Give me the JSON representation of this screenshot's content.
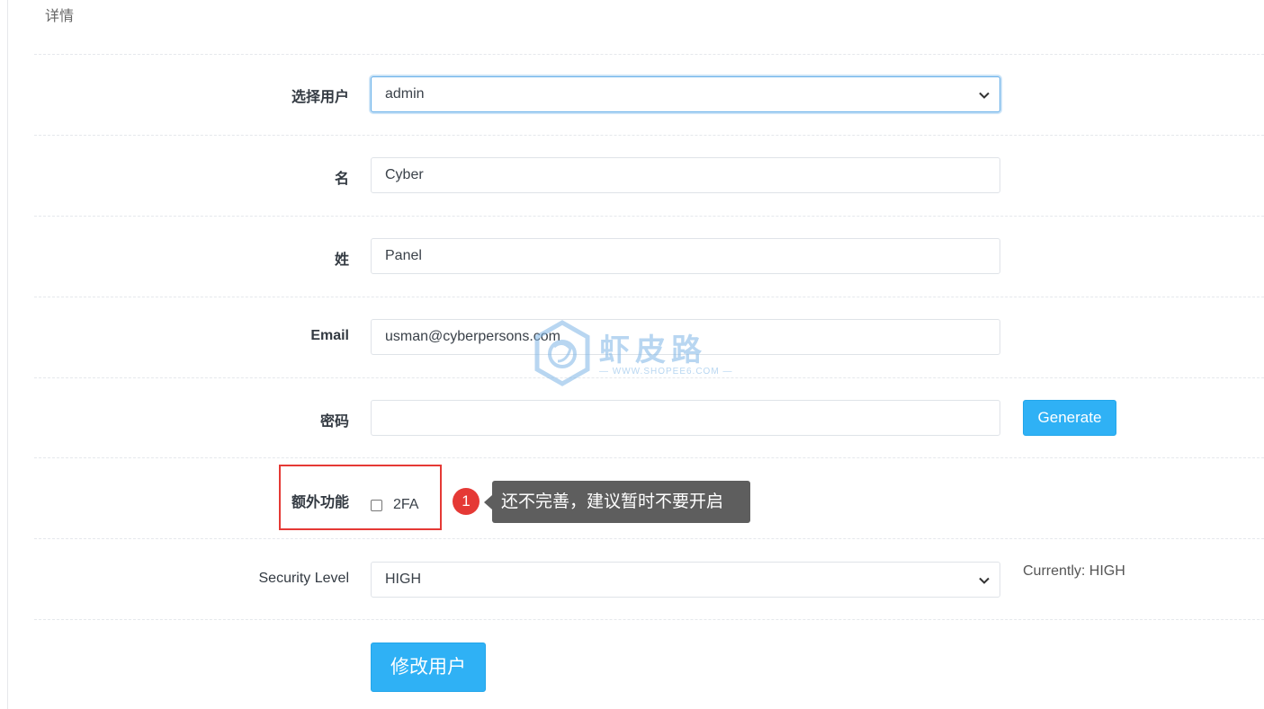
{
  "section": {
    "title": "详情"
  },
  "form": {
    "user_select": {
      "label": "选择用户",
      "value": "admin"
    },
    "first_name": {
      "label": "名",
      "value": "Cyber"
    },
    "last_name": {
      "label": "姓",
      "value": "Panel"
    },
    "email": {
      "label": "Email",
      "value": "usman@cyberpersons.com"
    },
    "password": {
      "label": "密码",
      "value": "",
      "generate_label": "Generate"
    },
    "features": {
      "label": "额外功能",
      "twofa_label": "2FA",
      "twofa_checked": false
    },
    "security_level": {
      "label": "Security Level",
      "value": "HIGH",
      "current": "Currently: HIGH"
    },
    "submit_label": "修改用户"
  },
  "annotation": {
    "number": "1",
    "text": "还不完善，建议暂时不要开启"
  },
  "watermark": {
    "title": "虾皮路",
    "subtitle": "— WWW.SHOPEE6.COM —"
  },
  "colors": {
    "accent": "#2fb1f5",
    "annotation_red": "#e53935",
    "tooltip_bg": "#5e5e5e"
  }
}
